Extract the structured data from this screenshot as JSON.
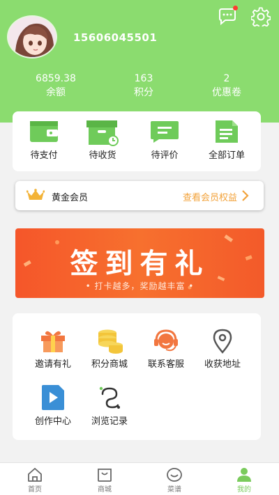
{
  "user": {
    "phone": "15606045501"
  },
  "stats": [
    {
      "value": "6859.38",
      "label": "余额"
    },
    {
      "value": "163",
      "label": "积分"
    },
    {
      "value": "2",
      "label": "优惠卷"
    }
  ],
  "orders": [
    {
      "label": "待支付",
      "icon": "wallet-icon"
    },
    {
      "label": "待收货",
      "icon": "delivery-box-icon"
    },
    {
      "label": "待评价",
      "icon": "review-icon"
    },
    {
      "label": "全部订单",
      "icon": "order-list-icon"
    }
  ],
  "vip": {
    "title": "黄金会员",
    "link": "查看会员权益"
  },
  "banner": {
    "title": "签到有礼",
    "subtitle": "• 打卡越多，奖励越丰富 •"
  },
  "tools": [
    {
      "label": "邀请有礼",
      "icon": "gift-icon"
    },
    {
      "label": "积分商城",
      "icon": "coins-icon"
    },
    {
      "label": "联系客服",
      "icon": "headset-icon"
    },
    {
      "label": "收获地址",
      "icon": "location-pin-icon"
    },
    {
      "label": "创作中心",
      "icon": "video-play-icon"
    },
    {
      "label": "浏览记录",
      "icon": "history-icon"
    }
  ],
  "tabs": [
    {
      "label": "首页",
      "icon": "home-icon"
    },
    {
      "label": "商城",
      "icon": "shop-bag-icon"
    },
    {
      "label": "菜谱",
      "icon": "smile-face-icon"
    },
    {
      "label": "我的",
      "icon": "person-icon",
      "active": true
    }
  ],
  "colors": {
    "brand_green": "#8bdc6f",
    "order_icon_green": "#6fcb5a",
    "banner_orange": "#f5562a",
    "vip_gold": "#f2a23a",
    "active_tab": "#7acb5c"
  }
}
